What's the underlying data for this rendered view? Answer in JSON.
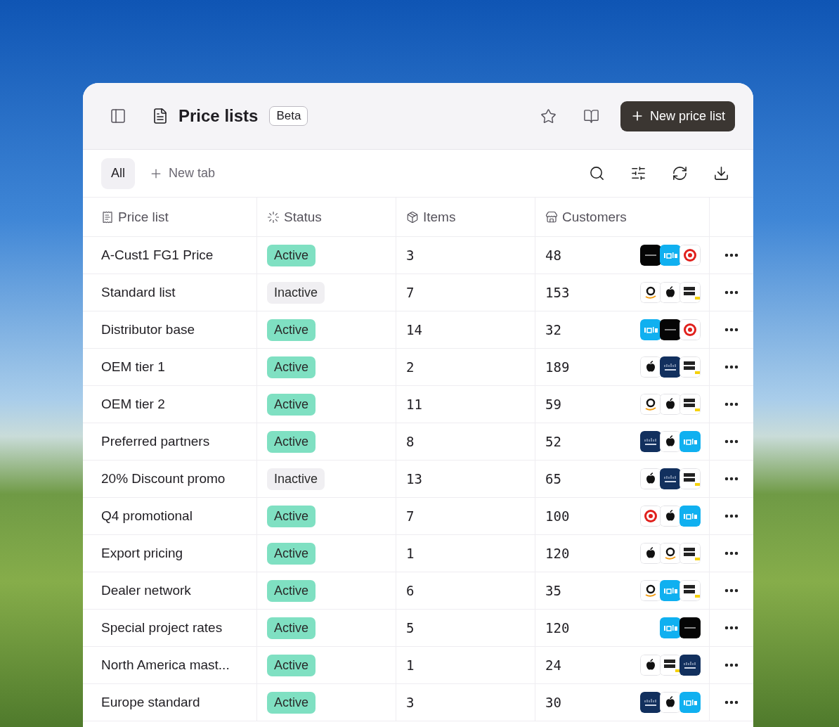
{
  "header": {
    "title": "Price lists",
    "badge": "Beta",
    "primary_button": "New price list"
  },
  "tabs": [
    {
      "label": "All",
      "selected": true
    }
  ],
  "new_tab_button": "New tab",
  "table": {
    "columns": [
      "Price list",
      "Status",
      "Items",
      "Customers"
    ],
    "rows": [
      {
        "name": "A-Cust1 FG1 Price",
        "status": "Active",
        "active": true,
        "items": "3",
        "customers": "48",
        "logos": [
          {
            "kind": "dark"
          },
          {
            "kind": "cyan"
          },
          {
            "kind": "rings"
          }
        ]
      },
      {
        "name": "Standard list",
        "status": "Inactive",
        "active": false,
        "items": "7",
        "customers": "153",
        "logos": [
          {
            "kind": "smile"
          },
          {
            "kind": "fruit"
          },
          {
            "kind": "tag"
          }
        ]
      },
      {
        "name": "Distributor base",
        "status": "Active",
        "active": true,
        "items": "14",
        "customers": "32",
        "logos": [
          {
            "kind": "cyan"
          },
          {
            "kind": "dark"
          },
          {
            "kind": "rings"
          }
        ]
      },
      {
        "name": "OEM tier 1",
        "status": "Active",
        "active": true,
        "items": "2",
        "customers": "189",
        "logos": [
          {
            "kind": "fruit"
          },
          {
            "kind": "navy"
          },
          {
            "kind": "tag"
          }
        ]
      },
      {
        "name": "OEM tier 2",
        "status": "Active",
        "active": true,
        "items": "11",
        "customers": "59",
        "logos": [
          {
            "kind": "smile"
          },
          {
            "kind": "fruit"
          },
          {
            "kind": "tag"
          }
        ]
      },
      {
        "name": "Preferred partners",
        "status": "Active",
        "active": true,
        "items": "8",
        "customers": "52",
        "logos": [
          {
            "kind": "navy"
          },
          {
            "kind": "fruit"
          },
          {
            "kind": "cyan"
          }
        ]
      },
      {
        "name": "20% Discount promo",
        "status": "Inactive",
        "active": false,
        "items": "13",
        "customers": "65",
        "logos": [
          {
            "kind": "fruit"
          },
          {
            "kind": "navy"
          },
          {
            "kind": "tag"
          }
        ]
      },
      {
        "name": "Q4 promotional",
        "status": "Active",
        "active": true,
        "items": "7",
        "customers": "100",
        "logos": [
          {
            "kind": "rings"
          },
          {
            "kind": "fruit"
          },
          {
            "kind": "cyan"
          }
        ]
      },
      {
        "name": "Export pricing",
        "status": "Active",
        "active": true,
        "items": "1",
        "customers": "120",
        "logos": [
          {
            "kind": "fruit"
          },
          {
            "kind": "smile"
          },
          {
            "kind": "tag"
          }
        ]
      },
      {
        "name": "Dealer network",
        "status": "Active",
        "active": true,
        "items": "6",
        "customers": "35",
        "logos": [
          {
            "kind": "smile"
          },
          {
            "kind": "cyan"
          },
          {
            "kind": "tag"
          }
        ]
      },
      {
        "name": "Special project rates",
        "status": "Active",
        "active": true,
        "items": "5",
        "customers": "120",
        "logos": [
          {
            "kind": "cyan"
          },
          {
            "kind": "dark"
          }
        ]
      },
      {
        "name": "North America mast...",
        "status": "Active",
        "active": true,
        "items": "1",
        "customers": "24",
        "logos": [
          {
            "kind": "fruit"
          },
          {
            "kind": "tag"
          },
          {
            "kind": "navy"
          }
        ]
      },
      {
        "name": "Europe standard",
        "status": "Active",
        "active": true,
        "items": "3",
        "customers": "30",
        "logos": [
          {
            "kind": "navy"
          },
          {
            "kind": "fruit"
          },
          {
            "kind": "cyan"
          }
        ]
      }
    ]
  }
}
